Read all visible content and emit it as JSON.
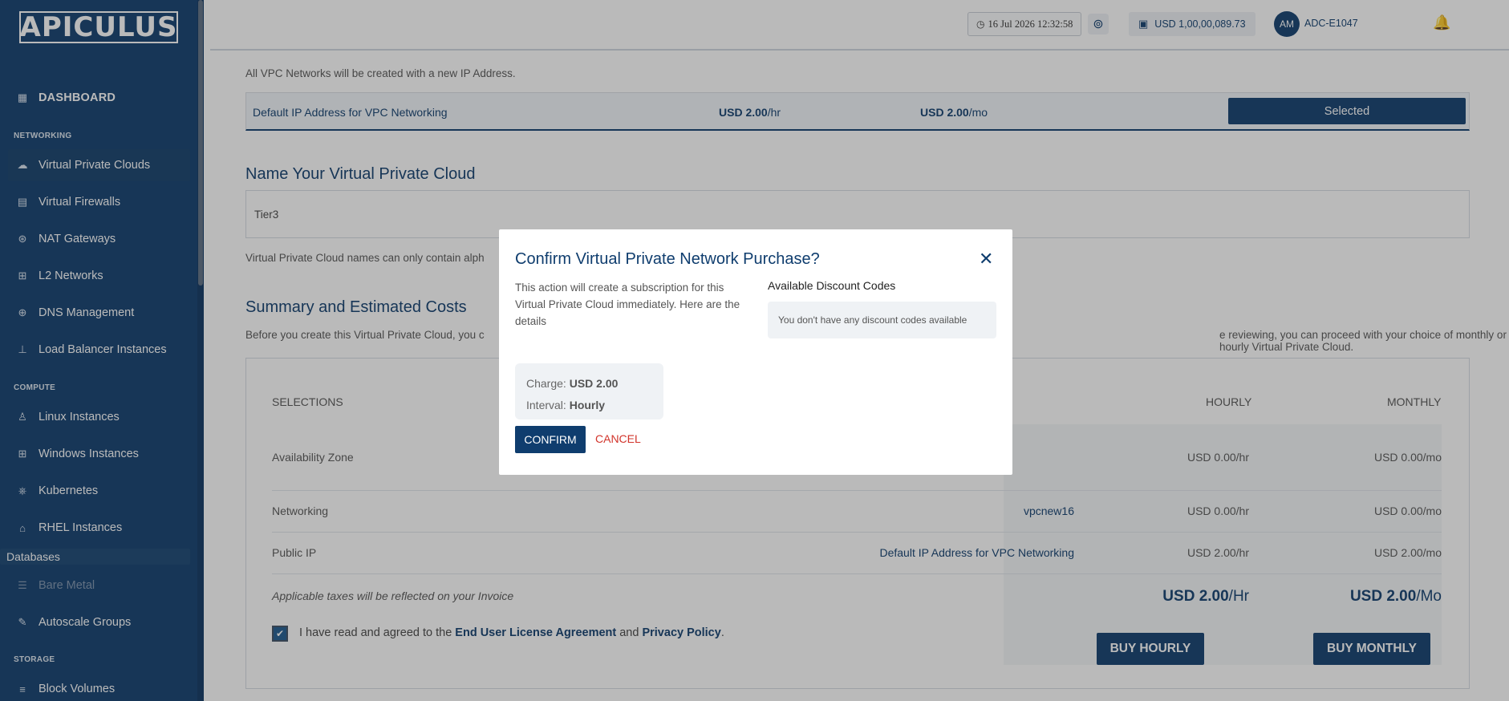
{
  "sidebar": {
    "logo": "APICULUS",
    "dashboard": "DASHBOARD",
    "sections": {
      "networking": "NETWORKING",
      "compute": "COMPUTE",
      "storage": "STORAGE"
    },
    "items": [
      {
        "label": "Virtual Private Clouds",
        "icon": "cloud-icon"
      },
      {
        "label": "Virtual Firewalls",
        "icon": "firewall-icon"
      },
      {
        "label": "NAT Gateways",
        "icon": "nat-icon"
      },
      {
        "label": "L2 Networks",
        "icon": "network-icon"
      },
      {
        "label": "DNS Management",
        "icon": "globe-icon"
      },
      {
        "label": "Load Balancer Instances",
        "icon": "load-balancer-icon"
      },
      {
        "label": "Linux Instances",
        "icon": "linux-icon"
      },
      {
        "label": "Windows Instances",
        "icon": "windows-icon"
      },
      {
        "label": "Kubernetes",
        "icon": "kubernetes-icon"
      },
      {
        "label": "RHEL Instances",
        "icon": "redhat-icon"
      },
      {
        "label": "Databases",
        "icon": ""
      },
      {
        "label": "Bare Metal",
        "icon": "server-icon"
      },
      {
        "label": "Autoscale Groups",
        "icon": "autoscale-icon"
      },
      {
        "label": "Block Volumes",
        "icon": "volumes-icon"
      }
    ]
  },
  "header": {
    "datetime": "16 Jul 2026 12:32:58",
    "balance": "USD 1,00,00,089.73",
    "avatar_initials": "AM",
    "account_id": "ADC-E1047"
  },
  "main": {
    "ip_section": {
      "desc": "All VPC Networks will be created with a new IP Address.",
      "row_name": "Default IP Address for VPC Networking",
      "price_hourly": "USD 2.00",
      "unit_hourly": "/hr",
      "price_monthly": "USD 2.00",
      "unit_monthly": "/mo",
      "selected_label": "Selected"
    },
    "name_section": {
      "title": "Name Your Virtual Private Cloud",
      "value": "Tier3",
      "hint": "Virtual Private Cloud names can only contain alph"
    },
    "summary": {
      "title": "Summary and Estimated Costs",
      "desc_left": "Before you create this Virtual Private Cloud, you c",
      "desc_right": "e reviewing, you can proceed with your choice of monthly or hourly Virtual Private Cloud.",
      "col_selections": "SELECTIONS",
      "col_hourly": "HOURLY",
      "col_monthly": "MONTHLY",
      "rows": [
        {
          "label": "Availability Zone",
          "value": "",
          "hourly": "USD 0.00/hr",
          "monthly": "USD 0.00/mo"
        },
        {
          "label": "Networking",
          "value": "vpcnew16",
          "hourly": "USD 0.00/hr",
          "monthly": "USD 0.00/mo"
        },
        {
          "label": "Public IP",
          "value": "Default IP Address for VPC Networking",
          "hourly": "USD 2.00/hr",
          "monthly": "USD 2.00/mo"
        }
      ],
      "taxes_note": "Applicable taxes will be reflected on your Invoice",
      "total_hourly_amount": "USD 2.00",
      "total_hourly_unit": "/Hr",
      "total_monthly_amount": "USD 2.00",
      "total_monthly_unit": "/Mo",
      "eula_prefix": "I have read and agreed to the ",
      "eula_link": "End User License Agreement",
      "eula_and": " and ",
      "privacy_link": "Privacy Policy",
      "eula_suffix": ".",
      "buy_hourly": "BUY HOURLY",
      "buy_monthly": "BUY MONTHLY"
    }
  },
  "modal": {
    "title": "Confirm Virtual Private Network Purchase?",
    "description": "This action will create a subscription for this Virtual Private Cloud immediately. Here are the details",
    "discount_title": "Available Discount Codes",
    "discount_empty": "You don't have any discount codes available",
    "charge_label": "Charge: ",
    "charge_value": "USD 2.00",
    "interval_label": "Interval: ",
    "interval_value": "Hourly",
    "confirm_label": "CONFIRM",
    "cancel_label": "CANCEL"
  },
  "colors": {
    "brand": "#0f3d6e",
    "cancel": "#d2342b"
  }
}
